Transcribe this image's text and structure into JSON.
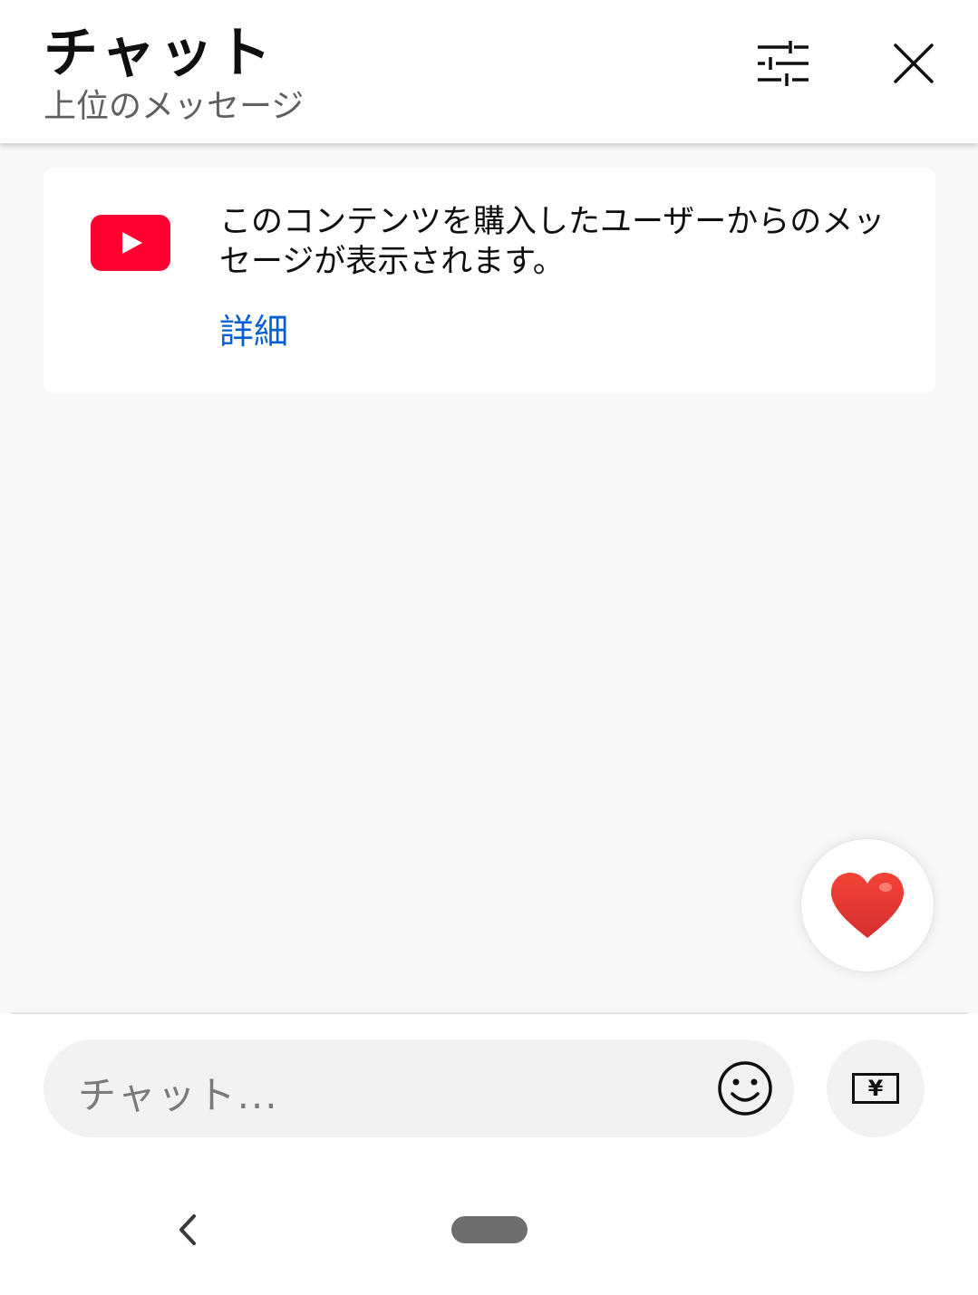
{
  "header": {
    "title": "チャット",
    "subtitle": "上位のメッセージ",
    "filter_icon": "tune-sliders-icon",
    "close_icon": "close-icon"
  },
  "notice": {
    "icon": "youtube-logo",
    "text": "このコンテンツを購入したユーザーからのメッセージが表示されます。",
    "link": "詳細"
  },
  "reaction": {
    "icon": "heart-icon",
    "emoji": "❤"
  },
  "input": {
    "placeholder": "チャット...",
    "emoji_icon": "smiley-face-icon",
    "super_chat_icon": "yen-icon",
    "super_chat_symbol": "¥"
  },
  "system_nav": {
    "back_icon": "chevron-left-icon",
    "home_icon": "home-pill-icon"
  },
  "colors": {
    "accent_link": "#065fd4",
    "youtube_red": "#ff0033",
    "heart_red": "#e53935",
    "chat_bg": "#f8f8f8"
  }
}
